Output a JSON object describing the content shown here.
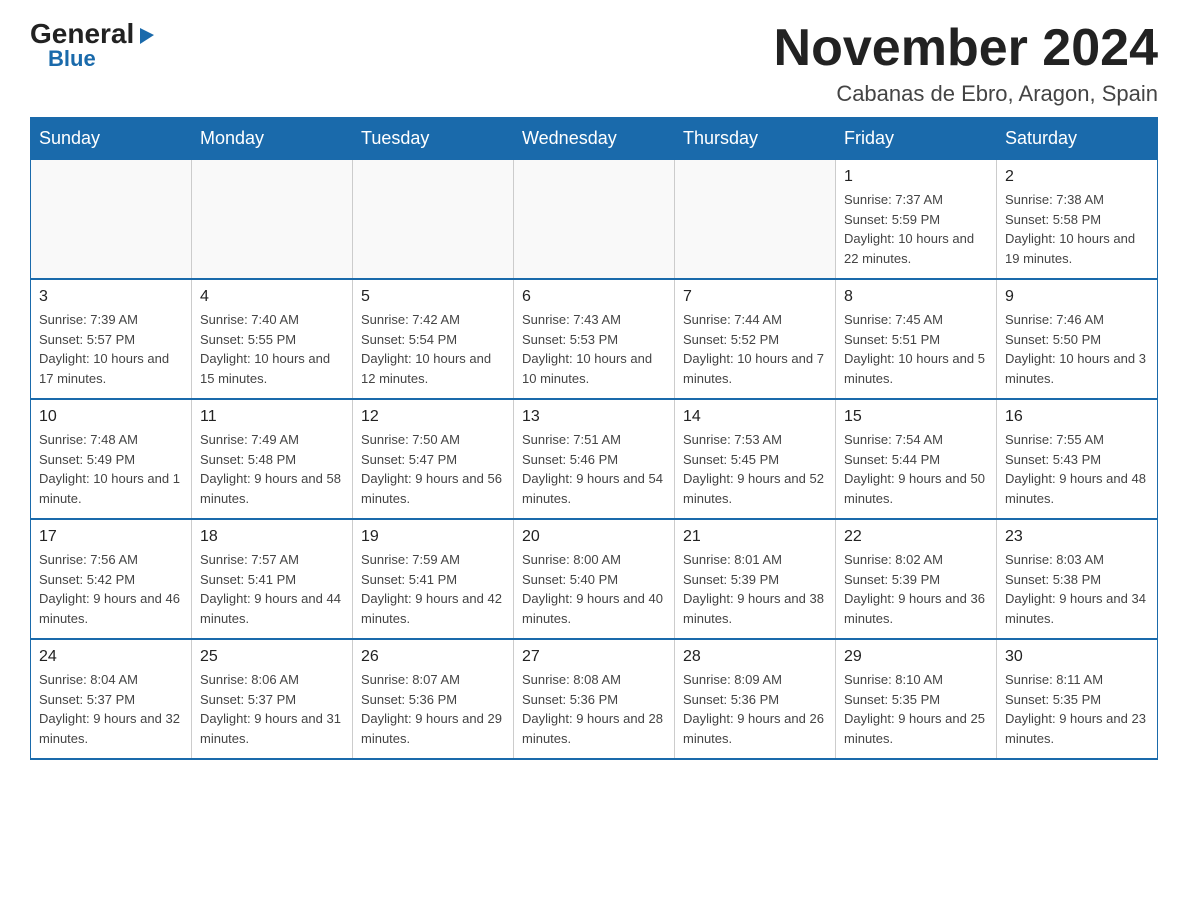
{
  "logo": {
    "general": "General",
    "triangle": "▶",
    "blue": "Blue"
  },
  "title": {
    "month": "November 2024",
    "location": "Cabanas de Ebro, Aragon, Spain"
  },
  "weekdays": [
    "Sunday",
    "Monday",
    "Tuesday",
    "Wednesday",
    "Thursday",
    "Friday",
    "Saturday"
  ],
  "weeks": [
    [
      {
        "day": "",
        "info": ""
      },
      {
        "day": "",
        "info": ""
      },
      {
        "day": "",
        "info": ""
      },
      {
        "day": "",
        "info": ""
      },
      {
        "day": "",
        "info": ""
      },
      {
        "day": "1",
        "info": "Sunrise: 7:37 AM\nSunset: 5:59 PM\nDaylight: 10 hours and 22 minutes."
      },
      {
        "day": "2",
        "info": "Sunrise: 7:38 AM\nSunset: 5:58 PM\nDaylight: 10 hours and 19 minutes."
      }
    ],
    [
      {
        "day": "3",
        "info": "Sunrise: 7:39 AM\nSunset: 5:57 PM\nDaylight: 10 hours and 17 minutes."
      },
      {
        "day": "4",
        "info": "Sunrise: 7:40 AM\nSunset: 5:55 PM\nDaylight: 10 hours and 15 minutes."
      },
      {
        "day": "5",
        "info": "Sunrise: 7:42 AM\nSunset: 5:54 PM\nDaylight: 10 hours and 12 minutes."
      },
      {
        "day": "6",
        "info": "Sunrise: 7:43 AM\nSunset: 5:53 PM\nDaylight: 10 hours and 10 minutes."
      },
      {
        "day": "7",
        "info": "Sunrise: 7:44 AM\nSunset: 5:52 PM\nDaylight: 10 hours and 7 minutes."
      },
      {
        "day": "8",
        "info": "Sunrise: 7:45 AM\nSunset: 5:51 PM\nDaylight: 10 hours and 5 minutes."
      },
      {
        "day": "9",
        "info": "Sunrise: 7:46 AM\nSunset: 5:50 PM\nDaylight: 10 hours and 3 minutes."
      }
    ],
    [
      {
        "day": "10",
        "info": "Sunrise: 7:48 AM\nSunset: 5:49 PM\nDaylight: 10 hours and 1 minute."
      },
      {
        "day": "11",
        "info": "Sunrise: 7:49 AM\nSunset: 5:48 PM\nDaylight: 9 hours and 58 minutes."
      },
      {
        "day": "12",
        "info": "Sunrise: 7:50 AM\nSunset: 5:47 PM\nDaylight: 9 hours and 56 minutes."
      },
      {
        "day": "13",
        "info": "Sunrise: 7:51 AM\nSunset: 5:46 PM\nDaylight: 9 hours and 54 minutes."
      },
      {
        "day": "14",
        "info": "Sunrise: 7:53 AM\nSunset: 5:45 PM\nDaylight: 9 hours and 52 minutes."
      },
      {
        "day": "15",
        "info": "Sunrise: 7:54 AM\nSunset: 5:44 PM\nDaylight: 9 hours and 50 minutes."
      },
      {
        "day": "16",
        "info": "Sunrise: 7:55 AM\nSunset: 5:43 PM\nDaylight: 9 hours and 48 minutes."
      }
    ],
    [
      {
        "day": "17",
        "info": "Sunrise: 7:56 AM\nSunset: 5:42 PM\nDaylight: 9 hours and 46 minutes."
      },
      {
        "day": "18",
        "info": "Sunrise: 7:57 AM\nSunset: 5:41 PM\nDaylight: 9 hours and 44 minutes."
      },
      {
        "day": "19",
        "info": "Sunrise: 7:59 AM\nSunset: 5:41 PM\nDaylight: 9 hours and 42 minutes."
      },
      {
        "day": "20",
        "info": "Sunrise: 8:00 AM\nSunset: 5:40 PM\nDaylight: 9 hours and 40 minutes."
      },
      {
        "day": "21",
        "info": "Sunrise: 8:01 AM\nSunset: 5:39 PM\nDaylight: 9 hours and 38 minutes."
      },
      {
        "day": "22",
        "info": "Sunrise: 8:02 AM\nSunset: 5:39 PM\nDaylight: 9 hours and 36 minutes."
      },
      {
        "day": "23",
        "info": "Sunrise: 8:03 AM\nSunset: 5:38 PM\nDaylight: 9 hours and 34 minutes."
      }
    ],
    [
      {
        "day": "24",
        "info": "Sunrise: 8:04 AM\nSunset: 5:37 PM\nDaylight: 9 hours and 32 minutes."
      },
      {
        "day": "25",
        "info": "Sunrise: 8:06 AM\nSunset: 5:37 PM\nDaylight: 9 hours and 31 minutes."
      },
      {
        "day": "26",
        "info": "Sunrise: 8:07 AM\nSunset: 5:36 PM\nDaylight: 9 hours and 29 minutes."
      },
      {
        "day": "27",
        "info": "Sunrise: 8:08 AM\nSunset: 5:36 PM\nDaylight: 9 hours and 28 minutes."
      },
      {
        "day": "28",
        "info": "Sunrise: 8:09 AM\nSunset: 5:36 PM\nDaylight: 9 hours and 26 minutes."
      },
      {
        "day": "29",
        "info": "Sunrise: 8:10 AM\nSunset: 5:35 PM\nDaylight: 9 hours and 25 minutes."
      },
      {
        "day": "30",
        "info": "Sunrise: 8:11 AM\nSunset: 5:35 PM\nDaylight: 9 hours and 23 minutes."
      }
    ]
  ]
}
